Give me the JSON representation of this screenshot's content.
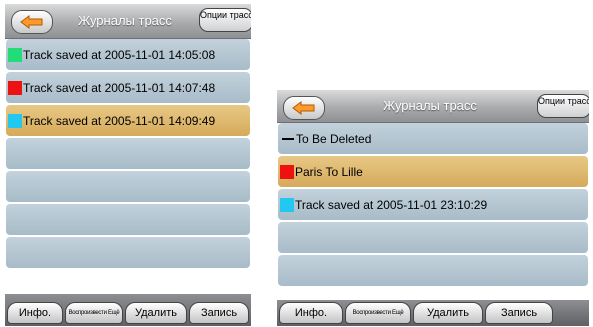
{
  "screen1": {
    "title": "Журналы трасс",
    "options_button": "Опции трассировки",
    "rows": [
      {
        "label": "Track saved at 2005-11-01 14:05:08",
        "color": "#22dd77"
      },
      {
        "label": "Track saved at 2005-11-01 14:07:48",
        "color": "#ee1111"
      },
      {
        "label": "Track saved at 2005-11-01 14:09:49",
        "color": "#22c8f0",
        "selected": true
      }
    ],
    "tabs": [
      "Инфо.",
      "Воспроизвести Ещё",
      "Удалить",
      "Запись"
    ]
  },
  "screen2": {
    "title": "Журналы трасс",
    "options_button": "Опции трассировки",
    "rows": [
      {
        "label": "To Be Deleted",
        "marker": "dash"
      },
      {
        "label": "Paris To Lille",
        "color": "#ee1111",
        "selected": true
      },
      {
        "label": "Track saved at 2005-11-01 23:10:29",
        "color": "#22c8f0"
      }
    ],
    "tabs": [
      "Инфо.",
      "Воспроизвести Ещё",
      "Удалить",
      "Запись"
    ]
  },
  "colors": {
    "row_bg": "#b5c6d2",
    "row_selected_bg": "#ddb870",
    "titlebar": "#a0a2a5"
  }
}
